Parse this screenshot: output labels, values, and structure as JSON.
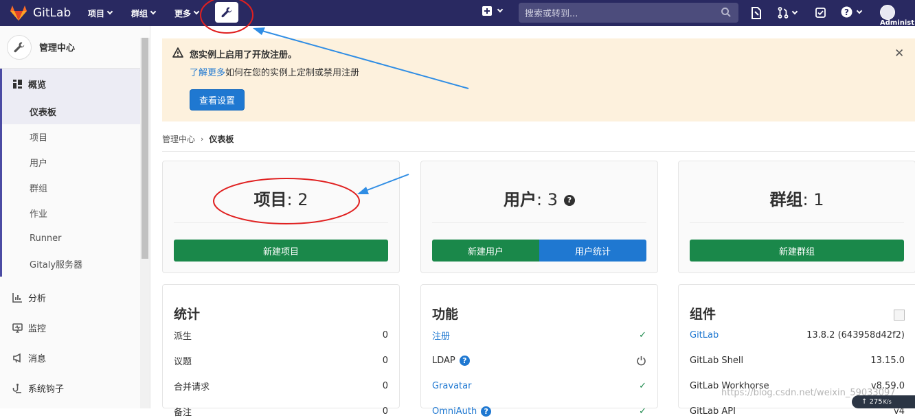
{
  "header": {
    "brand": "GitLab",
    "nav": [
      {
        "label": "项目"
      },
      {
        "label": "群组"
      },
      {
        "label": "更多"
      }
    ],
    "search_placeholder": "搜索或转到...",
    "username": "Administ"
  },
  "sidebar": {
    "title": "管理中心",
    "overview_label": "概览",
    "sub_items": [
      {
        "label": "仪表板"
      },
      {
        "label": "项目"
      },
      {
        "label": "用户"
      },
      {
        "label": "群组"
      },
      {
        "label": "作业"
      },
      {
        "label": "Runner"
      },
      {
        "label": "Gitaly服务器"
      }
    ],
    "sections": [
      {
        "label": "分析",
        "icon": "analytics-icon"
      },
      {
        "label": "监控",
        "icon": "monitor-icon"
      },
      {
        "label": "消息",
        "icon": "messages-icon"
      },
      {
        "label": "系统钩子",
        "icon": "hook-icon"
      }
    ]
  },
  "alert": {
    "title": "您实例上启用了开放注册。",
    "link_text": "了解更多",
    "description_rest": "如何在您的实例上定制或禁用注册",
    "button": "查看设置"
  },
  "breadcrumb": {
    "root": "管理中心",
    "current": "仪表板"
  },
  "cards": {
    "projects": {
      "label": "项目",
      "count": "2",
      "button": "新建项目"
    },
    "users": {
      "label": "用户",
      "count": "3",
      "button": "新建用户",
      "button2": "用户统计"
    },
    "groups": {
      "label": "群组",
      "count": "1",
      "button": "新建群组"
    }
  },
  "stats": {
    "title": "统计",
    "rows": [
      {
        "label": "派生",
        "value": "0"
      },
      {
        "label": "议题",
        "value": "0"
      },
      {
        "label": "合并请求",
        "value": "0"
      },
      {
        "label": "备注",
        "value": "0"
      }
    ]
  },
  "features": {
    "title": "功能",
    "rows": [
      {
        "label": "注册"
      },
      {
        "label": "LDAP"
      },
      {
        "label": "Gravatar"
      },
      {
        "label": "OmniAuth"
      }
    ]
  },
  "components": {
    "title": "组件",
    "rows": [
      {
        "label": "GitLab",
        "value": "13.8.2 (643958d42f2)"
      },
      {
        "label": "GitLab Shell",
        "value": "13.15.0"
      },
      {
        "label": "GitLab Workhorse",
        "value": "v8.59.0"
      },
      {
        "label": "GitLab API",
        "value": "v4"
      }
    ]
  },
  "overlay": {
    "watermark": "https://blog.csdn.net/weixin_59033097",
    "net_speed": "275",
    "net_speed_unit": "K/s"
  },
  "colors": {
    "topbar": "#292961",
    "green": "#1a884a",
    "blue": "#1f78d1",
    "alert_bg": "#fdf1dd",
    "annotation_red": "#e02020",
    "annotation_arrow": "#2f8de4"
  }
}
